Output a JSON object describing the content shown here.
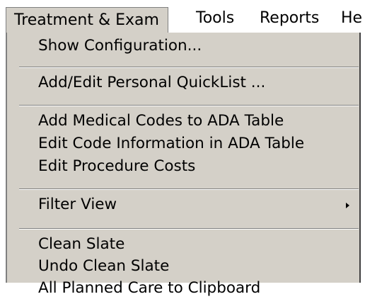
{
  "menubar": {
    "items": [
      "Treatment & Exam",
      "Tools",
      "Reports",
      "He"
    ]
  },
  "menu": {
    "items": [
      "Show Configuration...",
      "Add/Edit Personal QuickList ...",
      "Add Medical Codes to ADA Table",
      "Edit Code Information in ADA Table",
      "Edit Procedure Costs",
      "Filter View",
      "Clean Slate",
      "Undo Clean Slate",
      "All Planned Care to Clipboard"
    ]
  },
  "icons": {
    "submenu_arrow": "chevron-right-icon"
  },
  "colors": {
    "menu_background": "#d4d0c8",
    "menubar_background": "#ffffff",
    "text": "#000000"
  }
}
